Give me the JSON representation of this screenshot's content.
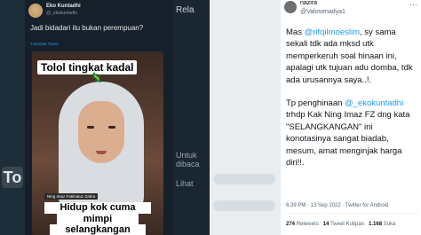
{
  "left_tweet": {
    "name": "Eko Kuntadhi",
    "handle": "@_ekokuntadhi",
    "text": "Jadi bidadari itu bukan perempuan?",
    "translate": "Translate Tweet",
    "video_captions": {
      "top": "Tolol tingkat kadal",
      "lower_third": "Ning Imaz Fatimatuz Zahra",
      "line1": "Hidup kok cuma",
      "line2": "mimpi",
      "line3": "selangkangan"
    }
  },
  "background_left": {
    "chip": "To",
    "side_text_1": "Rela",
    "side_text_2": "Untuk dibaca",
    "side_text_3": "Lihat"
  },
  "right_tweet": {
    "username": "nazira",
    "handle": "@Valosenadya1",
    "paragraph1": "Mas @rifqilmoeslim, sy sama sekali tdk ada mksd utk memperkeruh soal hinaan ini, apalagi utk tujuan adu domba, tdk ada urusannya saya..!.",
    "mention1": "@rifqilmoeslim",
    "p1_before": "Mas ",
    "p1_after": ", sy sama sekali tdk ada mksd utk memperkeruh soal hinaan ini, apalagi utk tujuan adu domba, tdk ada urusannya saya..!.",
    "p2_before": "Tp penghinaan ",
    "mention2": "@_ekokuntadhi",
    "p2_after": " trhdp Kak Ning Imaz FZ dng kata \"SELANGKANGAN\" ini konotasinya sangat biadab, mesum, amat menginjak harga diri!!.",
    "meta": "6.39 PM · 13 Sep 2022 · Twitter for Android",
    "retweets": "274",
    "retweets_label": "Retweets",
    "quotes": "14",
    "quotes_label": "Tweet Kutipan",
    "likes": "1.168",
    "likes_label": "Suka",
    "more": "···"
  }
}
